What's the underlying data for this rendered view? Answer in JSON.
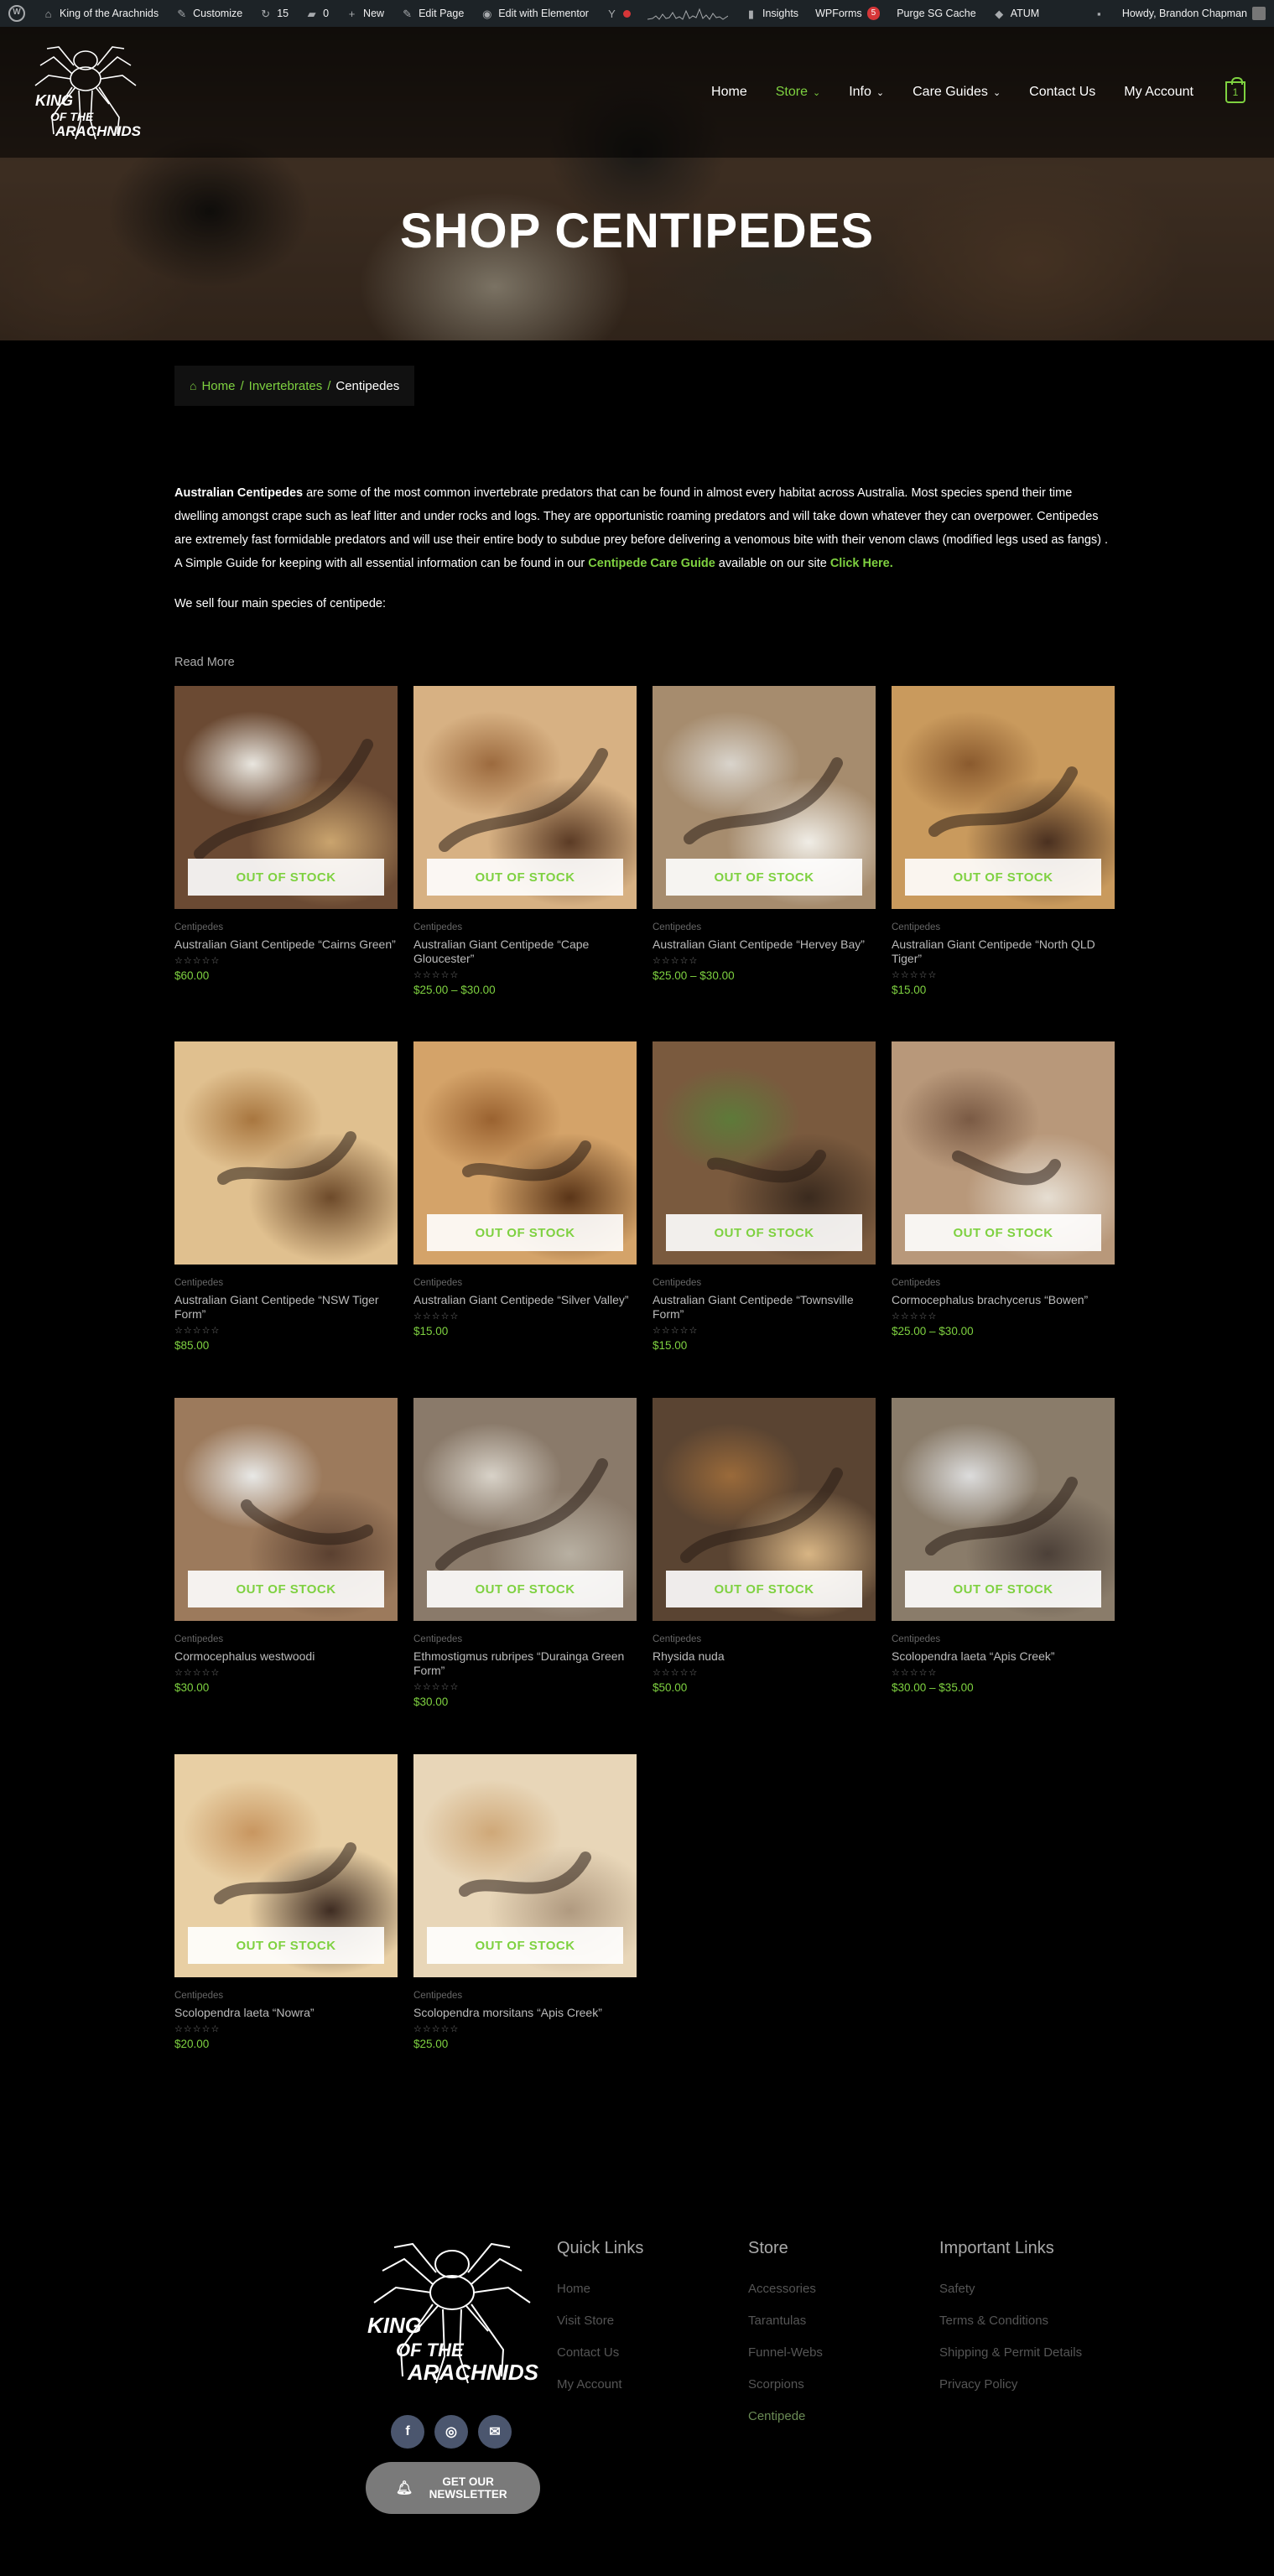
{
  "admin_bar": {
    "site_name": "King of the Arachnids",
    "customize": "Customize",
    "updates": "15",
    "comments": "0",
    "new": "New",
    "edit_page": "Edit Page",
    "edit_elementor": "Edit with Elementor",
    "insights": "Insights",
    "wpforms": "WPForms",
    "wpforms_badge": "5",
    "purge": "Purge SG Cache",
    "atum": "ATUM",
    "howdy": "Howdy, Brandon Chapman"
  },
  "header": {
    "logo_text": [
      "KING",
      "OF THE",
      "ARACHNIDS"
    ],
    "nav": [
      {
        "label": "Home",
        "dropdown": false,
        "active": false
      },
      {
        "label": "Store",
        "dropdown": true,
        "active": true
      },
      {
        "label": "Info",
        "dropdown": true,
        "active": false
      },
      {
        "label": "Care Guides",
        "dropdown": true,
        "active": false
      },
      {
        "label": "Contact Us",
        "dropdown": false,
        "active": false
      },
      {
        "label": "My Account",
        "dropdown": false,
        "active": false
      }
    ],
    "cart_count": "1"
  },
  "hero": {
    "title": "SHOP CENTIPEDES"
  },
  "breadcrumb": {
    "home": "Home",
    "sep": "/",
    "level2": "Invertebrates",
    "current": "Centipedes"
  },
  "description": {
    "bold_intro": "Australian Centipedes",
    "text1": " are some of the most common invertebrate predators that can be found in almost every habitat across Australia. Most species spend their time dwelling amongst crape such as leaf litter and under rocks and logs. They are opportunistic roaming predators and will take down whatever they can overpower. Centipedes are extremely fast formidable predators and will use their entire body to subdue prey before delivering a venomous bite with their venom claws (modified legs used as fangs) . A Simple Guide for keeping with all essential information can be found in our ",
    "link1": "Centipede Care Guide",
    "text2": " available on our site ",
    "link2": "Click Here.",
    "line2": "We sell four main species of centipede:",
    "read_more": "Read More"
  },
  "products": [
    {
      "category": "Centipedes",
      "name": "Australian Giant Centipede “Cairns Green”",
      "price": "$60.00",
      "badge": "OUT OF STOCK"
    },
    {
      "category": "Centipedes",
      "name": "Australian Giant Centipede “Cape Gloucester”",
      "price": "$25.00 – $30.00",
      "badge": "OUT OF STOCK"
    },
    {
      "category": "Centipedes",
      "name": "Australian Giant Centipede “Hervey Bay”",
      "price": "$25.00 – $30.00",
      "badge": "OUT OF STOCK"
    },
    {
      "category": "Centipedes",
      "name": "Australian Giant Centipede “North QLD Tiger”",
      "price": "$15.00",
      "badge": "OUT OF STOCK"
    },
    {
      "category": "Centipedes",
      "name": "Australian Giant Centipede “NSW Tiger Form”",
      "price": "$85.00",
      "badge": ""
    },
    {
      "category": "Centipedes",
      "name": "Australian Giant Centipede “Silver Valley”",
      "price": "$15.00",
      "badge": "OUT OF STOCK"
    },
    {
      "category": "Centipedes",
      "name": "Australian Giant Centipede “Townsville Form”",
      "price": "$15.00",
      "badge": "OUT OF STOCK"
    },
    {
      "category": "Centipedes",
      "name": "Cormocephalus brachycerus “Bowen”",
      "price": "$25.00 – $30.00",
      "badge": "OUT OF STOCK"
    },
    {
      "category": "Centipedes",
      "name": "Cormocephalus westwoodi",
      "price": "$30.00",
      "badge": "OUT OF STOCK"
    },
    {
      "category": "Centipedes",
      "name": "Ethmostigmus rubripes “Durainga Green Form”",
      "price": "$30.00",
      "badge": "OUT OF STOCK"
    },
    {
      "category": "Centipedes",
      "name": "Rhysida nuda",
      "price": "$50.00",
      "badge": "OUT OF STOCK"
    },
    {
      "category": "Centipedes",
      "name": "Scolopendra laeta “Apis Creek”",
      "price": "$30.00 – $35.00",
      "badge": "OUT OF STOCK"
    },
    {
      "category": "Centipedes",
      "name": "Scolopendra laeta “Nowra”",
      "price": "$20.00",
      "badge": "OUT OF STOCK"
    },
    {
      "category": "Centipedes",
      "name": "Scolopendra morsitans “Apis Creek”",
      "price": "$25.00",
      "badge": "OUT OF STOCK"
    }
  ],
  "rating_stars": "☆☆☆☆☆",
  "footer": {
    "logo_text": [
      "KING",
      "OF THE",
      "ARACHNIDS"
    ],
    "newsletter": "GET OUR NEWSLETTER",
    "columns": [
      {
        "title": "Quick Links",
        "links": [
          "Home",
          "Visit Store",
          "Contact Us",
          "My Account"
        ]
      },
      {
        "title": "Store",
        "links": [
          "Accessories",
          "Tarantulas",
          "Funnel-Webs",
          "Scorpions",
          "Centipede"
        ]
      },
      {
        "title": "Important Links",
        "links": [
          "Safety",
          "Terms & Conditions",
          "Shipping & Permit Details",
          "Privacy Policy"
        ]
      }
    ]
  },
  "colors": {
    "accent": "#7ed140",
    "admin_bar": "#1d2327",
    "background": "#000000"
  }
}
